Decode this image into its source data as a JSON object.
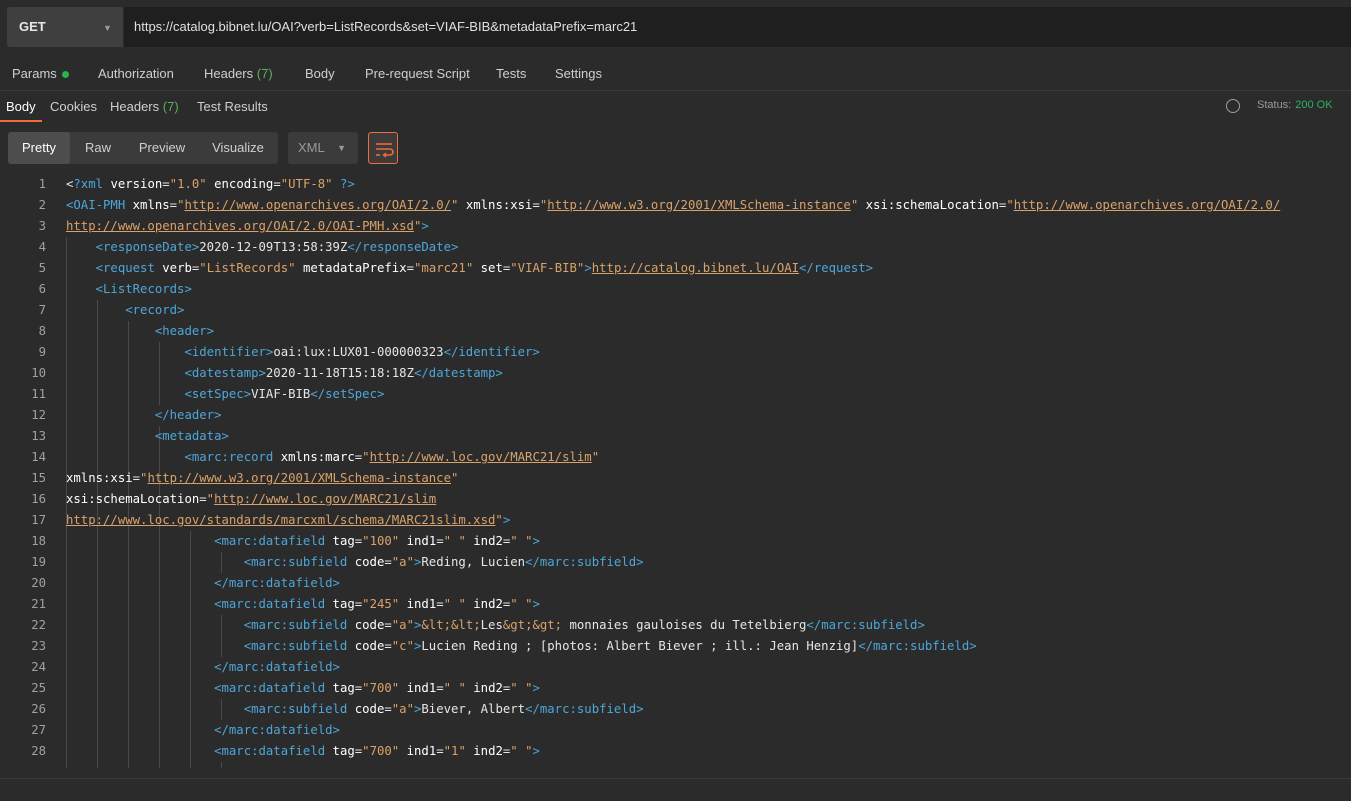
{
  "request": {
    "method": "GET",
    "url": "https://catalog.bibnet.lu/OAI?verb=ListRecords&set=VIAF-BIB&metadataPrefix=marc21"
  },
  "request_tabs": {
    "params": "Params",
    "authorization": "Authorization",
    "headers": "Headers",
    "headers_count": "(7)",
    "body": "Body",
    "prerequest": "Pre-request Script",
    "tests": "Tests",
    "settings": "Settings"
  },
  "response_tabs": {
    "body": "Body",
    "cookies": "Cookies",
    "headers": "Headers",
    "headers_count": "(7)",
    "test_results": "Test Results"
  },
  "status": {
    "label": "Status:",
    "code": "200 OK"
  },
  "view": {
    "pretty": "Pretty",
    "raw": "Raw",
    "preview": "Preview",
    "visualize": "Visualize",
    "language": "XML"
  },
  "code_lines": [
    {
      "n": "1",
      "t": [
        [
          "x",
          "<"
        ],
        [
          "t",
          "?xml"
        ],
        [
          "x",
          " "
        ],
        [
          "a",
          "version"
        ],
        [
          "x",
          "="
        ],
        [
          "v",
          "\"1.0\""
        ],
        [
          "x",
          " "
        ],
        [
          "a",
          "encoding"
        ],
        [
          "x",
          "="
        ],
        [
          "v",
          "\"UTF-8\""
        ],
        [
          "x",
          " "
        ],
        [
          "t",
          "?>"
        ]
      ]
    },
    {
      "n": "2",
      "t": [
        [
          "t",
          "<OAI-PMH"
        ],
        [
          "x",
          " "
        ],
        [
          "a",
          "xmlns"
        ],
        [
          "x",
          "="
        ],
        [
          "v",
          "\""
        ],
        [
          "u",
          "http://www.openarchives.org/OAI/2.0/"
        ],
        [
          "v",
          "\""
        ],
        [
          "x",
          " "
        ],
        [
          "a",
          "xmlns:xsi"
        ],
        [
          "x",
          "="
        ],
        [
          "v",
          "\""
        ],
        [
          "u",
          "http://www.w3.org/2001/XMLSchema-instance"
        ],
        [
          "v",
          "\""
        ],
        [
          "x",
          " "
        ],
        [
          "a",
          "xsi:schemaLocation"
        ],
        [
          "x",
          "="
        ],
        [
          "v",
          "\""
        ],
        [
          "u",
          "http://www.openarchives.org/OAI/2.0/"
        ]
      ]
    },
    {
      "n": "3",
      "t": [
        [
          "u",
          "http://www.openarchives.org/OAI/2.0/OAI-PMH.xsd"
        ],
        [
          "v",
          "\""
        ],
        [
          "t",
          ">"
        ]
      ]
    },
    {
      "n": "4",
      "t": [
        [
          "x",
          "    "
        ],
        [
          "t",
          "<responseDate>"
        ],
        [
          "x",
          "2020-12-09T13:58:39Z"
        ],
        [
          "t",
          "</responseDate>"
        ]
      ]
    },
    {
      "n": "5",
      "t": [
        [
          "x",
          "    "
        ],
        [
          "t",
          "<request"
        ],
        [
          "x",
          " "
        ],
        [
          "a",
          "verb"
        ],
        [
          "x",
          "="
        ],
        [
          "v",
          "\"ListRecords\""
        ],
        [
          "x",
          " "
        ],
        [
          "a",
          "metadataPrefix"
        ],
        [
          "x",
          "="
        ],
        [
          "v",
          "\"marc21\""
        ],
        [
          "x",
          " "
        ],
        [
          "a",
          "set"
        ],
        [
          "x",
          "="
        ],
        [
          "v",
          "\"VIAF-BIB\""
        ],
        [
          "t",
          ">"
        ],
        [
          "u",
          "http://catalog.bibnet.lu/OAI"
        ],
        [
          "t",
          "</request>"
        ]
      ]
    },
    {
      "n": "6",
      "t": [
        [
          "x",
          "    "
        ],
        [
          "t",
          "<ListRecords>"
        ]
      ]
    },
    {
      "n": "7",
      "t": [
        [
          "x",
          "        "
        ],
        [
          "t",
          "<record>"
        ]
      ]
    },
    {
      "n": "8",
      "t": [
        [
          "x",
          "            "
        ],
        [
          "t",
          "<header>"
        ]
      ]
    },
    {
      "n": "9",
      "t": [
        [
          "x",
          "                "
        ],
        [
          "t",
          "<identifier>"
        ],
        [
          "x",
          "oai:lux:LUX01-000000323"
        ],
        [
          "t",
          "</identifier>"
        ]
      ]
    },
    {
      "n": "10",
      "t": [
        [
          "x",
          "                "
        ],
        [
          "t",
          "<datestamp>"
        ],
        [
          "x",
          "2020-11-18T15:18:18Z"
        ],
        [
          "t",
          "</datestamp>"
        ]
      ]
    },
    {
      "n": "11",
      "t": [
        [
          "x",
          "                "
        ],
        [
          "t",
          "<setSpec>"
        ],
        [
          "x",
          "VIAF-BIB"
        ],
        [
          "t",
          "</setSpec>"
        ]
      ]
    },
    {
      "n": "12",
      "t": [
        [
          "x",
          "            "
        ],
        [
          "t",
          "</header>"
        ]
      ]
    },
    {
      "n": "13",
      "t": [
        [
          "x",
          "            "
        ],
        [
          "t",
          "<metadata>"
        ]
      ]
    },
    {
      "n": "14",
      "t": [
        [
          "x",
          "                "
        ],
        [
          "t",
          "<marc:record"
        ],
        [
          "x",
          " "
        ],
        [
          "a",
          "xmlns:marc"
        ],
        [
          "x",
          "="
        ],
        [
          "v",
          "\""
        ],
        [
          "u",
          "http://www.loc.gov/MARC21/slim"
        ],
        [
          "v",
          "\""
        ]
      ]
    },
    {
      "n": "15",
      "t": [
        [
          "a",
          "xmlns:xsi"
        ],
        [
          "x",
          "="
        ],
        [
          "v",
          "\""
        ],
        [
          "u",
          "http://www.w3.org/2001/XMLSchema-instance"
        ],
        [
          "v",
          "\""
        ]
      ]
    },
    {
      "n": "16",
      "t": [
        [
          "a",
          "xsi:schemaLocation"
        ],
        [
          "x",
          "="
        ],
        [
          "v",
          "\""
        ],
        [
          "u",
          "http://www.loc.gov/MARC21/slim"
        ]
      ]
    },
    {
      "n": "17",
      "t": [
        [
          "u",
          "http://www.loc.gov/standards/marcxml/schema/MARC21slim.xsd"
        ],
        [
          "v",
          "\""
        ],
        [
          "t",
          ">"
        ]
      ]
    },
    {
      "n": "18",
      "t": [
        [
          "x",
          "                    "
        ],
        [
          "t",
          "<marc:datafield"
        ],
        [
          "x",
          " "
        ],
        [
          "a",
          "tag"
        ],
        [
          "x",
          "="
        ],
        [
          "v",
          "\"100\""
        ],
        [
          "x",
          " "
        ],
        [
          "a",
          "ind1"
        ],
        [
          "x",
          "="
        ],
        [
          "v",
          "\" \""
        ],
        [
          "x",
          " "
        ],
        [
          "a",
          "ind2"
        ],
        [
          "x",
          "="
        ],
        [
          "v",
          "\" \""
        ],
        [
          "t",
          ">"
        ]
      ]
    },
    {
      "n": "19",
      "t": [
        [
          "x",
          "                        "
        ],
        [
          "t",
          "<marc:subfield"
        ],
        [
          "x",
          " "
        ],
        [
          "a",
          "code"
        ],
        [
          "x",
          "="
        ],
        [
          "v",
          "\"a\""
        ],
        [
          "t",
          ">"
        ],
        [
          "x",
          "Reding, Lucien"
        ],
        [
          "t",
          "</marc:subfield>"
        ]
      ]
    },
    {
      "n": "20",
      "t": [
        [
          "x",
          "                    "
        ],
        [
          "t",
          "</marc:datafield>"
        ]
      ]
    },
    {
      "n": "21",
      "t": [
        [
          "x",
          "                    "
        ],
        [
          "t",
          "<marc:datafield"
        ],
        [
          "x",
          " "
        ],
        [
          "a",
          "tag"
        ],
        [
          "x",
          "="
        ],
        [
          "v",
          "\"245\""
        ],
        [
          "x",
          " "
        ],
        [
          "a",
          "ind1"
        ],
        [
          "x",
          "="
        ],
        [
          "v",
          "\" \""
        ],
        [
          "x",
          " "
        ],
        [
          "a",
          "ind2"
        ],
        [
          "x",
          "="
        ],
        [
          "v",
          "\" \""
        ],
        [
          "t",
          ">"
        ]
      ]
    },
    {
      "n": "22",
      "t": [
        [
          "x",
          "                        "
        ],
        [
          "t",
          "<marc:subfield"
        ],
        [
          "x",
          " "
        ],
        [
          "a",
          "code"
        ],
        [
          "x",
          "="
        ],
        [
          "v",
          "\"a\""
        ],
        [
          "t",
          ">"
        ],
        [
          "v",
          "&lt;&lt;"
        ],
        [
          "x",
          "Les"
        ],
        [
          "v",
          "&gt;&gt;"
        ],
        [
          "x",
          " monnaies gauloises du Tetelbierg"
        ],
        [
          "t",
          "</marc:subfield>"
        ]
      ]
    },
    {
      "n": "23",
      "t": [
        [
          "x",
          "                        "
        ],
        [
          "t",
          "<marc:subfield"
        ],
        [
          "x",
          " "
        ],
        [
          "a",
          "code"
        ],
        [
          "x",
          "="
        ],
        [
          "v",
          "\"c\""
        ],
        [
          "t",
          ">"
        ],
        [
          "x",
          "Lucien Reding ; [photos: Albert Biever ; ill.: Jean Henzig]"
        ],
        [
          "t",
          "</marc:subfield>"
        ]
      ]
    },
    {
      "n": "24",
      "t": [
        [
          "x",
          "                    "
        ],
        [
          "t",
          "</marc:datafield>"
        ]
      ]
    },
    {
      "n": "25",
      "t": [
        [
          "x",
          "                    "
        ],
        [
          "t",
          "<marc:datafield"
        ],
        [
          "x",
          " "
        ],
        [
          "a",
          "tag"
        ],
        [
          "x",
          "="
        ],
        [
          "v",
          "\"700\""
        ],
        [
          "x",
          " "
        ],
        [
          "a",
          "ind1"
        ],
        [
          "x",
          "="
        ],
        [
          "v",
          "\" \""
        ],
        [
          "x",
          " "
        ],
        [
          "a",
          "ind2"
        ],
        [
          "x",
          "="
        ],
        [
          "v",
          "\" \""
        ],
        [
          "t",
          ">"
        ]
      ]
    },
    {
      "n": "26",
      "t": [
        [
          "x",
          "                        "
        ],
        [
          "t",
          "<marc:subfield"
        ],
        [
          "x",
          " "
        ],
        [
          "a",
          "code"
        ],
        [
          "x",
          "="
        ],
        [
          "v",
          "\"a\""
        ],
        [
          "t",
          ">"
        ],
        [
          "x",
          "Biever, Albert"
        ],
        [
          "t",
          "</marc:subfield>"
        ]
      ]
    },
    {
      "n": "27",
      "t": [
        [
          "x",
          "                    "
        ],
        [
          "t",
          "</marc:datafield>"
        ]
      ]
    },
    {
      "n": "28",
      "t": [
        [
          "x",
          "                    "
        ],
        [
          "t",
          "<marc:datafield"
        ],
        [
          "x",
          " "
        ],
        [
          "a",
          "tag"
        ],
        [
          "x",
          "="
        ],
        [
          "v",
          "\"700\""
        ],
        [
          "x",
          " "
        ],
        [
          "a",
          "ind1"
        ],
        [
          "x",
          "="
        ],
        [
          "v",
          "\"1\""
        ],
        [
          "x",
          " "
        ],
        [
          "a",
          "ind2"
        ],
        [
          "x",
          "="
        ],
        [
          "v",
          "\" \""
        ],
        [
          "t",
          ">"
        ]
      ]
    }
  ]
}
